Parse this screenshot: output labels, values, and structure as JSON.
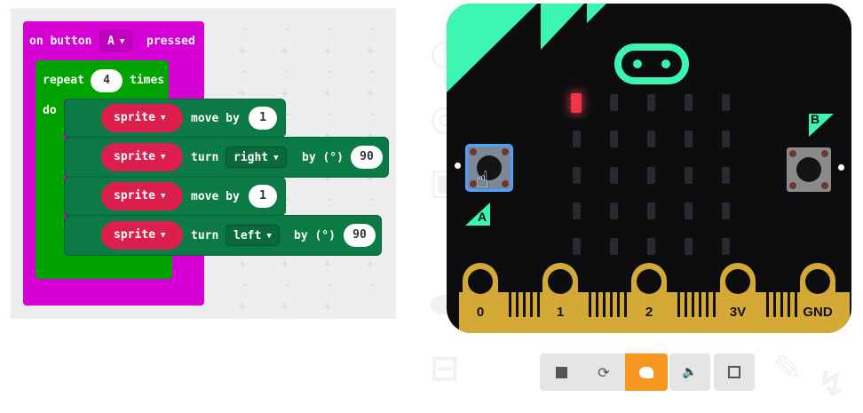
{
  "event_block": {
    "label": "on button",
    "button_value": "A",
    "suffix": "pressed"
  },
  "loop_block": {
    "label": "repeat",
    "count": "4",
    "suffix": "times",
    "do_label": "do"
  },
  "statements": [
    {
      "sprite": "sprite",
      "action": "move by",
      "value": "1"
    },
    {
      "sprite": "sprite",
      "action": "turn",
      "direction": "right",
      "by_label": "by (°)",
      "value": "90"
    },
    {
      "sprite": "sprite",
      "action": "move by",
      "value": "1"
    },
    {
      "sprite": "sprite",
      "action": "turn",
      "direction": "left",
      "by_label": "by (°)",
      "value": "90"
    }
  ],
  "simulator": {
    "button_a_label": "A",
    "button_b_label": "B",
    "pins": [
      "0",
      "1",
      "2",
      "3V",
      "GND"
    ],
    "lit_leds": [
      [
        0,
        0
      ]
    ],
    "colors": {
      "board": "#0d0d10",
      "accent": "#3cf5b0",
      "led_on": "#f0354a",
      "gold": "#d4a935"
    }
  },
  "toolbar": {
    "buttons": [
      {
        "name": "stop",
        "icon": "stop-icon"
      },
      {
        "name": "restart",
        "icon": "restart-icon"
      },
      {
        "name": "slow-mo",
        "icon": "snail-icon",
        "active": true
      },
      {
        "name": "mute",
        "icon": "speaker-icon"
      },
      {
        "name": "fullscreen",
        "icon": "fullscreen-icon"
      }
    ]
  }
}
